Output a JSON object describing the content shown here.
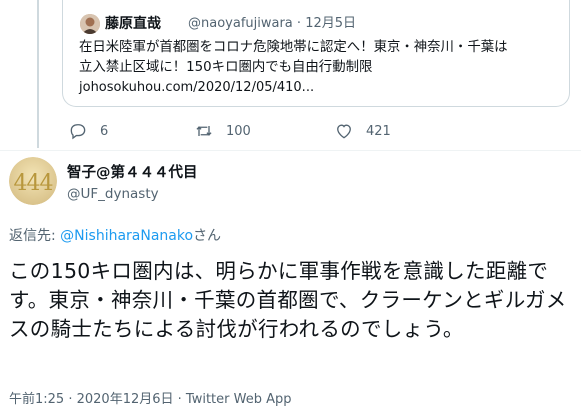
{
  "quoted_tweet": {
    "author_name": "藤原直哉",
    "author_handle": "@naoyafujiwara",
    "separator": "·",
    "date": "12月5日",
    "text": "在日米陸軍が首都圏をコロナ危険地帯に認定へ！東京・神奈川・千葉は\n立入禁止区域に！150キロ圏内でも自由行動制限",
    "link": "johosokuhou.com/2020/12/05/410..."
  },
  "actions": {
    "reply_count": "6",
    "retweet_count": "100",
    "like_count": "421"
  },
  "tweet": {
    "avatar_text": "444",
    "author_name": "智子@第４４４代目",
    "author_handle": "@UF_dynasty",
    "reply_prefix": "返信先: ",
    "reply_mention": "@NishiharaNanako",
    "reply_suffix": "さん",
    "text": "この150キロ圏内は、明らかに軍事作戦を意識した距離です。東京・神奈川・千葉の首都圏で、クラーケンとギルガメスの騎士たちによる討伐が行われるのでしょう。",
    "time": "午前1:25",
    "separator": " · ",
    "date": "2020年12月6日",
    "source": "Twitter Web App"
  },
  "colors": {
    "accent": "#1d9bf0",
    "secondary_text": "#536471",
    "border": "#cfd9de",
    "avatar_gold": "#b8973c"
  },
  "icons": [
    "reply-icon",
    "retweet-icon",
    "like-icon"
  ]
}
